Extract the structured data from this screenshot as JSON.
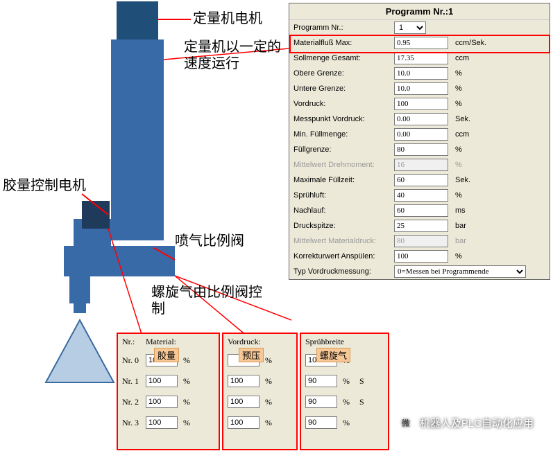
{
  "labels": {
    "motor": "定量机电机",
    "run": "定量机以一定的速度运行",
    "glueMotor": "胶量控制电机",
    "propValve": "喷气比例阀",
    "spiral": "螺旋气由比例阀控制",
    "watermark": "机器人及PLC自动化应用",
    "wechat": "微"
  },
  "panel": {
    "title": "Programm Nr.:1",
    "progLabel": "Programm Nr.:",
    "progValue": "1",
    "rows": [
      {
        "k": "Materialfluß Max:",
        "v": "0.95",
        "u": "ccm/Sek."
      },
      {
        "k": "Sollmenge Gesamt:",
        "v": "17.35",
        "u": "ccm"
      },
      {
        "k": "Obere Grenze:",
        "v": "10.0",
        "u": "%"
      },
      {
        "k": "Untere Grenze:",
        "v": "10.0",
        "u": "%"
      },
      {
        "k": "Vordruck:",
        "v": "100",
        "u": "%"
      },
      {
        "k": "Messpunkt Vordruck:",
        "v": "0.00",
        "u": "Sek."
      },
      {
        "k": "Min. Füllmenge:",
        "v": "0.00",
        "u": "ccm"
      },
      {
        "k": "Füllgrenze:",
        "v": "80",
        "u": "%"
      },
      {
        "k": "Mittelwert Drehmoment:",
        "v": "16",
        "u": "%",
        "d": true
      },
      {
        "k": "Maximale Füllzeit:",
        "v": "60",
        "u": "Sek."
      },
      {
        "k": "Sprühluft:",
        "v": "40",
        "u": "%"
      },
      {
        "k": "Nachlauf:",
        "v": "60",
        "u": "ms"
      },
      {
        "k": "Druckspitze:",
        "v": "25",
        "u": "bar"
      },
      {
        "k": "Mittelwert Materialdruck:",
        "v": "80",
        "u": "bar",
        "d": true
      },
      {
        "k": "Korrekturwert Anspülen:",
        "v": "100",
        "u": "%"
      }
    ],
    "selLabel": "Typ Vordruckmessung:",
    "selValue": "0=Messen bei Programmende"
  },
  "sub": {
    "h1": "Nr.:",
    "h2": "Material:",
    "h3": "Vordruck:",
    "h4": "Sprühbreite",
    "tag1": "胶量",
    "tag2": "预压",
    "tag3": "螺旋气",
    "rows": [
      {
        "n": "Nr. 0",
        "m": "100",
        "p": "",
        "s": "100",
        "sx": ""
      },
      {
        "n": "Nr. 1",
        "m": "100",
        "p": "100",
        "s": "90",
        "sx": "S"
      },
      {
        "n": "Nr. 2",
        "m": "100",
        "p": "100",
        "s": "90",
        "sx": "S"
      },
      {
        "n": "Nr. 3",
        "m": "100",
        "p": "100",
        "s": "90",
        "sx": ""
      }
    ]
  }
}
